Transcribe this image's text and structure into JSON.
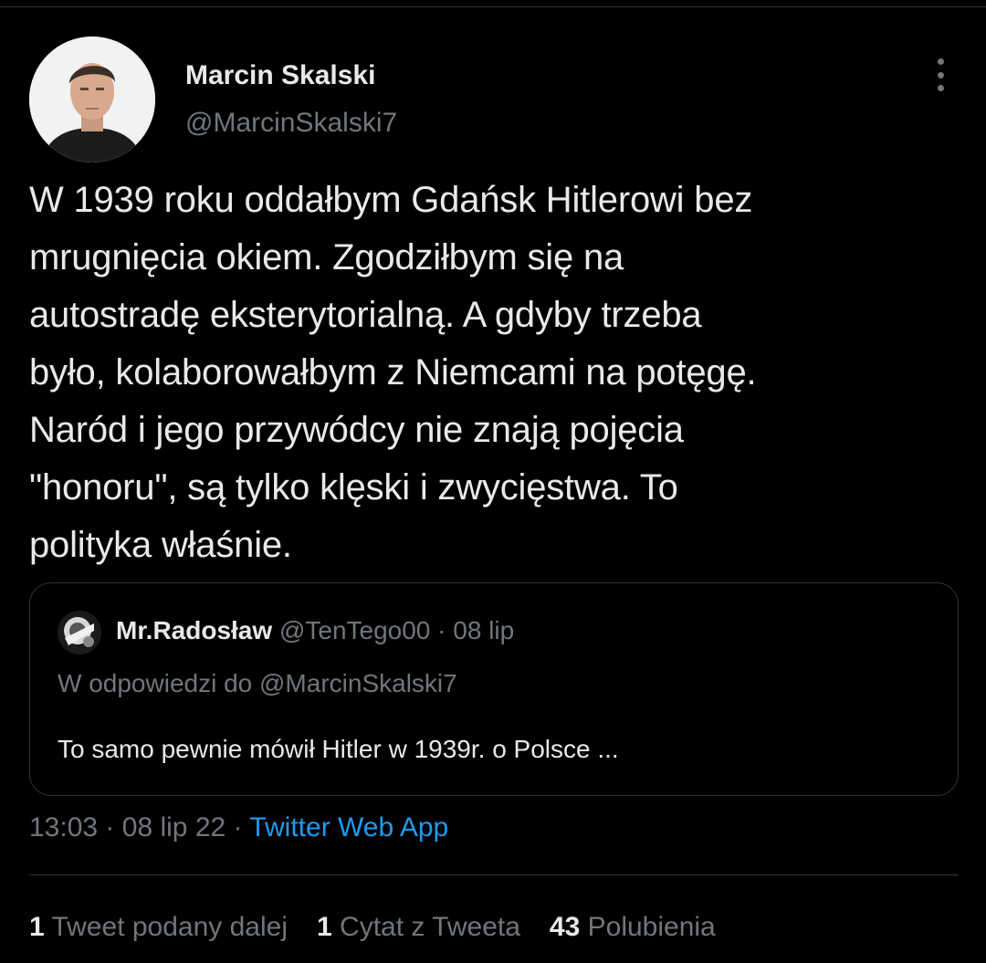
{
  "author": {
    "name": "Marcin Skalski",
    "handle": "@MarcinSkalski7"
  },
  "tweet": {
    "text": "W 1939 roku oddałbym Gdańsk Hitlerowi bez\nmrugnięcia okiem. Zgodziłbym się na\nautostradę eksterytorialną. A gdyby trzeba\nbyło, kolaborowałbym z Niemcami na potęgę.\nNaród i jego przywódcy nie znają pojęcia\n\"honoru\", są tylko klęski i zwycięstwa. To\npolityka właśnie.",
    "time": "13:03",
    "separator": "·",
    "date": "08 lip 22",
    "source": "Twitter Web App"
  },
  "quote": {
    "name": "Mr.Radosław",
    "handle": "@TenTego00",
    "separator": "·",
    "date": "08 lip",
    "reply_to": "W odpowiedzi do @MarcinSkalski7",
    "text": "To samo pewnie mówił Hitler w 1939r. o Polsce ..."
  },
  "stats": {
    "retweets_count": "1",
    "retweets_label": "Tweet podany dalej",
    "quotes_count": "1",
    "quotes_label": "Cytat z Tweeta",
    "likes_count": "43",
    "likes_label": "Polubienia"
  },
  "icons": {
    "more": "more-vertical-icon"
  },
  "colors": {
    "background": "#000000",
    "text_primary": "#e7e9ea",
    "text_secondary": "#71767b",
    "link": "#1d9bf0",
    "divider": "#2f3336"
  }
}
